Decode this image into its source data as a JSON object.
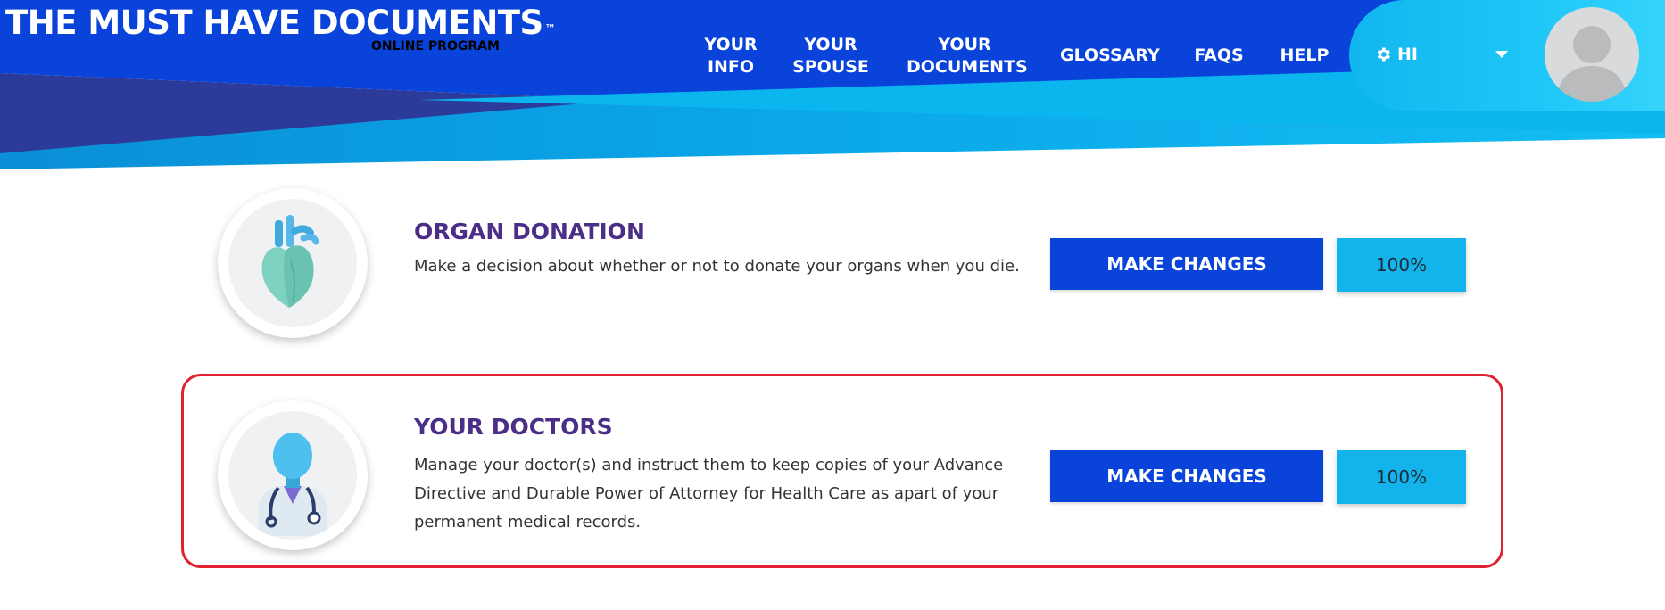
{
  "app": {
    "logo_title": "THE MUST HAVE DOCUMENTS",
    "logo_trademark": "™",
    "logo_subtitle": "ONLINE PROGRAM"
  },
  "nav": {
    "items": [
      {
        "line1": "YOUR",
        "line2": "INFO"
      },
      {
        "line1": "YOUR",
        "line2": "SPOUSE"
      },
      {
        "line1": "YOUR",
        "line2": "DOCUMENTS"
      },
      {
        "line1": "GLOSSARY",
        "line2": ""
      },
      {
        "line1": "FAQS",
        "line2": ""
      },
      {
        "line1": "HELP",
        "line2": ""
      }
    ]
  },
  "user": {
    "greeting": "HI",
    "settings_icon": "gear-icon",
    "menu_icon": "caret-down-icon",
    "avatar_icon": "default-avatar-icon"
  },
  "cards": [
    {
      "title": "ORGAN DONATION",
      "description": "Make a decision about whether or not to donate your organs when you die.",
      "button_label": "MAKE CHANGES",
      "progress_label": "100%",
      "progress_value": 100,
      "icon": "heart-icon"
    },
    {
      "title": "YOUR DOCTORS",
      "description": "Manage your doctor(s) and instruct them to keep copies of your Advance Directive and Durable Power of Attorney for Health Care as apart of your permanent medical records.",
      "button_label": "MAKE CHANGES",
      "progress_label": "100%",
      "progress_value": 100,
      "icon": "doctor-icon",
      "highlighted": true
    }
  ],
  "colors": {
    "header_blue": "#0a43d9",
    "header_navy": "#2c3a9a",
    "header_cyan": "#12b6ef",
    "title_purple": "#4b2e87",
    "button_blue": "#0a43d9",
    "progress_cyan": "#13b4ec",
    "highlight_red": "#e0212f"
  }
}
